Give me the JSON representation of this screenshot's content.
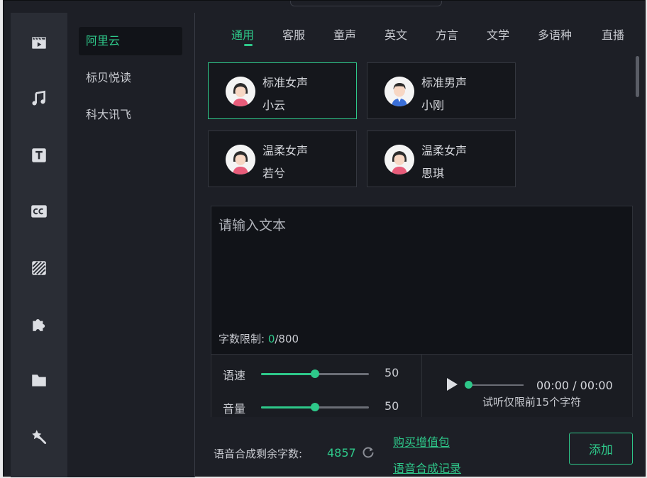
{
  "sidebar": {
    "icons": [
      {
        "name": "video-clip-icon"
      },
      {
        "name": "music-icon"
      },
      {
        "name": "text-icon"
      },
      {
        "name": "subtitle-cc-icon"
      },
      {
        "name": "filter-icon"
      },
      {
        "name": "plugin-icon"
      },
      {
        "name": "folder-icon"
      },
      {
        "name": "effects-wand-icon"
      }
    ]
  },
  "providers": [
    {
      "label": "阿里云",
      "active": true
    },
    {
      "label": "标贝悦读",
      "active": false
    },
    {
      "label": "科大讯飞",
      "active": false
    }
  ],
  "tabs": [
    {
      "label": "通用",
      "active": true
    },
    {
      "label": "客服"
    },
    {
      "label": "童声"
    },
    {
      "label": "英文"
    },
    {
      "label": "方言"
    },
    {
      "label": "文学"
    },
    {
      "label": "多语种"
    },
    {
      "label": "直播"
    }
  ],
  "voices": [
    {
      "type": "标准女声",
      "name": "小云",
      "gender": "female",
      "selected": true
    },
    {
      "type": "标准男声",
      "name": "小刚",
      "gender": "male",
      "selected": false
    },
    {
      "type": "温柔女声",
      "name": "若兮",
      "gender": "female",
      "selected": false
    },
    {
      "type": "温柔女声",
      "name": "思琪",
      "gender": "female",
      "selected": false
    }
  ],
  "editor": {
    "placeholder": "请输入文本",
    "char_limit_label": "字数限制: ",
    "char_current": "0",
    "char_max": "/800"
  },
  "controls": {
    "speed": {
      "label": "语速",
      "value": "50",
      "fill_fraction": 0.5
    },
    "volume": {
      "label": "音量",
      "value": "50",
      "fill_fraction": 0.5
    }
  },
  "preview": {
    "time": "00:00 / 00:00",
    "note": "试听仅限前15个字符",
    "progress_fraction": 0
  },
  "footer": {
    "remaining_label": "语音合成剩余字数:",
    "remaining_count": "4857",
    "buy_link": "购买增值包",
    "history_link": "语音合成记录",
    "add_button": "添加"
  },
  "colors": {
    "accent": "#2ec88a",
    "background": "#1d1f26",
    "sidebar": "#2a2d35"
  }
}
